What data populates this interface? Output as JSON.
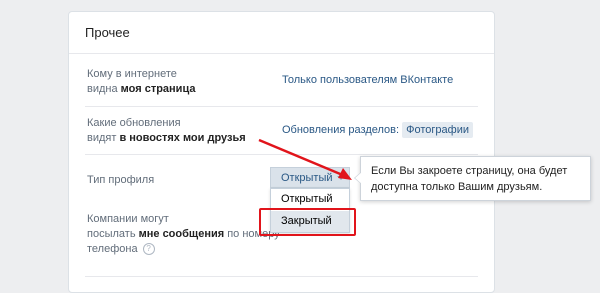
{
  "panel": {
    "title": "Прочее"
  },
  "rows": {
    "page_visible": {
      "label_line1": "Кому в интернете",
      "label_line2_plain": "видна ",
      "label_line2_bold": "моя страница",
      "value": "Только пользователям ВКонтакте"
    },
    "friends_news": {
      "label_line1": "Какие обновления",
      "label_line2_plain": "видят ",
      "label_line2_bold": "в новостях мои друзья",
      "value_prefix": "Обновления разделов:",
      "value_chip": "Фотографии"
    },
    "profile_type": {
      "label": "Тип профиля",
      "selected": "Открытый",
      "options": [
        "Открытый",
        "Закрытый"
      ]
    },
    "companies": {
      "line1": "Компании могут",
      "line2_plain_a": "посылать ",
      "line2_bold": "мне сообщения",
      "line2_plain_b": " по номеру",
      "line3": "телефона",
      "help_glyph": "?"
    }
  },
  "tooltip": {
    "line1": "Если Вы закроете страницу, она будет",
    "line2": "доступна только Вашим друзьям."
  },
  "colors": {
    "accent": "#2a5885",
    "annotation_red": "#e1141b",
    "background": "#edeef0"
  }
}
